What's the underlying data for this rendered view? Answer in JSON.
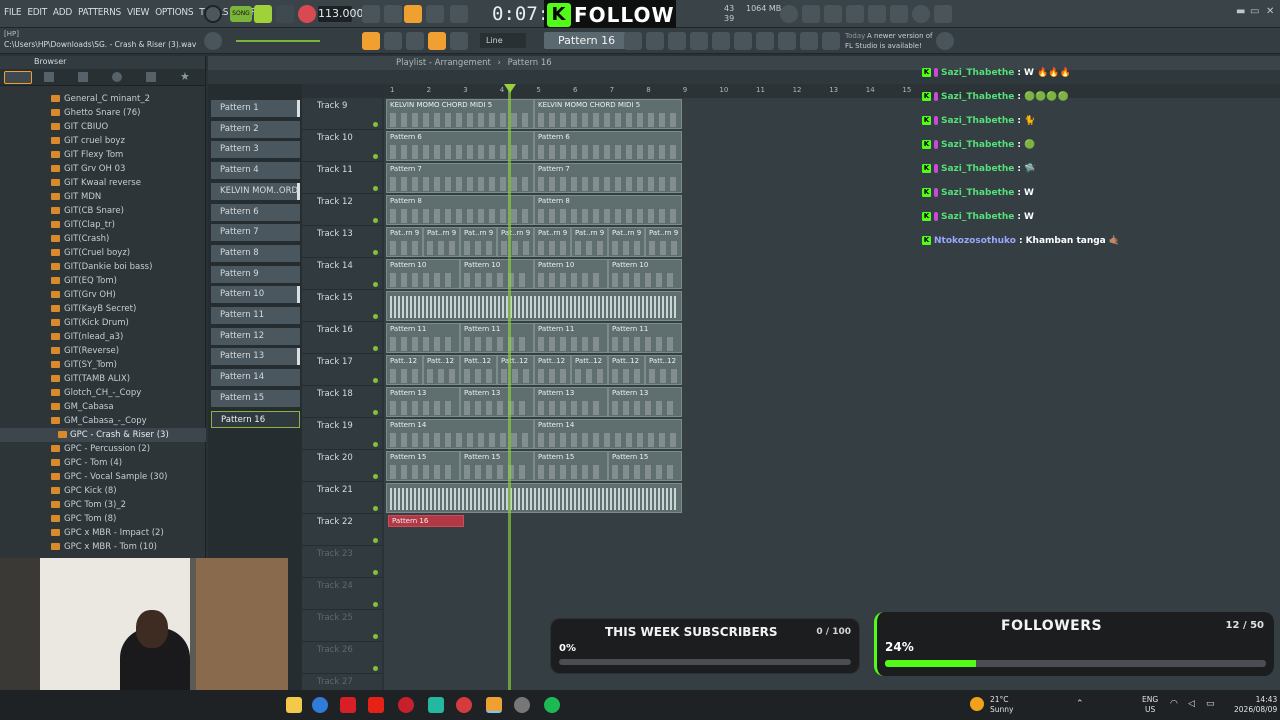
{
  "menu": [
    "FILE",
    "EDIT",
    "ADD",
    "PATTERNS",
    "VIEW",
    "OPTIONS",
    "TOOLS",
    "HELP"
  ],
  "transport": {
    "mode": "SONG",
    "tempo": "113.000",
    "time": "0:07:",
    "memory_mb": "1064 MB",
    "cpu": "43",
    "poly": "39"
  },
  "follow_badge": {
    "k": "K",
    "text": "FOLLOW"
  },
  "path": {
    "label": "[HP]",
    "value": "C:\\Users\\HP\\Downloads\\SG. - Crash & Riser (3).wav"
  },
  "snap": "Line",
  "current_pattern": "Pattern 16",
  "hint": {
    "day": "Today",
    "line1": "A newer version of",
    "line2": "FL Studio is available!"
  },
  "browser": {
    "title": "Browser",
    "items": [
      "General_C minant_2",
      "Ghetto Snare (76)",
      "GIT CBIUO",
      "GIT cruel boyz",
      "GIT Flexy Tom",
      "GIT Grv OH 03",
      "GIT Kwaal reverse",
      "GIT MDN",
      "GIT(CB Snare)",
      "GIT(Clap_tr)",
      "GIT(Crash)",
      "GIT(Cruel boyz)",
      "GIT(Dankie boi bass)",
      "GIT(EQ Tom)",
      "GIT(Grv OH)",
      "GIT(KayB Secret)",
      "GIT(Kick Drum)",
      "GIT(nlead_a3)",
      "GIT(Reverse)",
      "GIT(SY_Tom)",
      "GIT(TAMB ALIX)",
      "Glotch_CH_-_Copy",
      "GM_Cabasa",
      "GM_Cabasa_-_Copy",
      "GPC - Crash & Riser (3)",
      "GPC - Percussion (2)",
      "GPC - Tom (4)",
      "GPC - Vocal Sample (30)",
      "GPC Kick (8)",
      "GPC Tom (3)_2",
      "GPC Tom (8)",
      "GPC x MBR - Impact (2)",
      "GPC x MBR - Tom (10)"
    ],
    "selected_index": 24
  },
  "playlist": {
    "title": "Playlist - Arrangement",
    "pattern": "Pattern 16",
    "patterns": [
      "Pattern 1",
      "Pattern 2",
      "Pattern 3",
      "Pattern 4",
      "KELVIN MOM..ORD MIDI 5",
      "Pattern 6",
      "Pattern 7",
      "Pattern 8",
      "Pattern 9",
      "Pattern 10",
      "Pattern 11",
      "Pattern 12",
      "Pattern 13",
      "Pattern 14",
      "Pattern 15",
      "Pattern 16"
    ],
    "ruler": [
      "1",
      "2",
      "3",
      "4",
      "5",
      "6",
      "7",
      "8",
      "9",
      "10",
      "11",
      "12",
      "13",
      "14",
      "15"
    ],
    "tracks": [
      "Track 9",
      "Track 10",
      "Track 11",
      "Track 12",
      "Track 13",
      "Track 14",
      "Track 15",
      "Track 16",
      "Track 17",
      "Track 18",
      "Track 19",
      "Track 20",
      "Track 21",
      "Track 22",
      "Track 23",
      "Track 24",
      "Track 25",
      "Track 26",
      "Track 27"
    ],
    "clip_labels": {
      "t9": "KELVIN MOMO CHORD MIDI 5",
      "t10": "Pattern 6",
      "t11": "Pattern 7",
      "t12": "Pattern 8",
      "t13": "Pat..rn 9",
      "t14": "Pattern 10",
      "t16": "Pattern 11",
      "t17": "Patt..12",
      "t18": "Pattern 13",
      "t19": "Pattern 14",
      "t20": "Pattern 15",
      "t22": "Pattern 16"
    }
  },
  "chat": [
    {
      "user": "Sazi_Thabethe",
      "sep": ":",
      "msg": "W 🔥🔥🔥"
    },
    {
      "user": "Sazi_Thabethe",
      "sep": ":",
      "msg": "🟢🟢🟢🟢"
    },
    {
      "user": "Sazi_Thabethe",
      "sep": ":",
      "msg": "🐈"
    },
    {
      "user": "Sazi_Thabethe",
      "sep": ":",
      "msg": "🟢"
    },
    {
      "user": "Sazi_Thabethe",
      "sep": ":",
      "msg": "🛸"
    },
    {
      "user": "Sazi_Thabethe",
      "sep": ":",
      "msg": "W"
    },
    {
      "user": "Sazi_Thabethe",
      "sep": ":",
      "msg": "W"
    },
    {
      "user": "Ntokozosothuko",
      "sep": ":",
      "msg": "Khamban tanga 🤙🏽"
    }
  ],
  "subscribers": {
    "title": "THIS WEEK SUBSCRIBERS",
    "count": "0 / 100",
    "percent_text": "0%",
    "fraction": 0.0
  },
  "followers": {
    "title": "FOLLOWERS",
    "count": "12 / 50",
    "percent_text": "24%",
    "fraction": 0.24
  },
  "taskbar": {
    "weather_temp": "21°C",
    "weather_desc": "Sunny",
    "lang1": "ENG",
    "lang2": "US",
    "time": "14:43",
    "date": "2026/08/09"
  },
  "colors": {
    "accent": "#f0a030",
    "kick_green": "#53fc18",
    "clip": "#5f6e6f",
    "clip_red": "#b13844"
  }
}
